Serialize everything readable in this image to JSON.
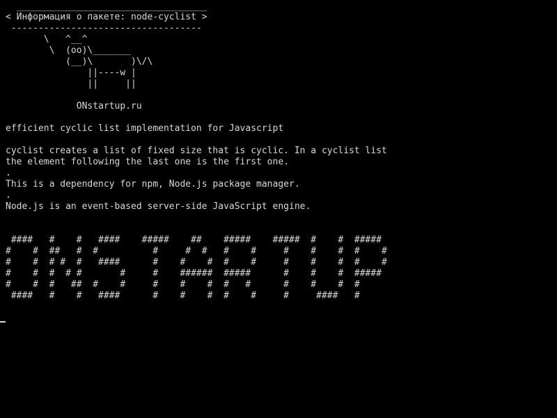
{
  "terminal": {
    "message_box": {
      "top_border": "  ___________________________________",
      "title": "< Информация о пакете: node-cyclist >",
      "bottom_border": " -----------------------------------"
    },
    "cow": [
      "       \\   ^__^",
      "        \\  (oo)\\_______",
      "           (__)\\       )\\/\\",
      "               ||----w |",
      "               ||     ||"
    ],
    "brand": "             ONstartup.ru",
    "summary": "efficient cyclic list implementation for Javascript",
    "description": [
      "cyclist creates a list of fixed size that is cyclic. In a cyclist list",
      "the element following the last one is the first one.",
      ".",
      "This is a dependency for npm, Node.js package manager.",
      ".",
      "Node.js is an event-based server-side JavaScript engine."
    ],
    "banner": [
      " ####   #    #   ####    #####    ##    #####    #####  #    #  #####",
      "#    #  ##   #  #          #     #  #   #    #     #    #    #  #    #",
      "#    #  # #  #   ####      #    #    #  #    #     #    #    #  #    #",
      "#    #  #  # #       #     #    ######  #####      #    #    #  #####",
      "#    #  #   ##  #    #     #    #    #  #   #      #    #    #  #",
      " ####   #    #   ####      #    #    #  #    #     #     ####   #"
    ]
  }
}
